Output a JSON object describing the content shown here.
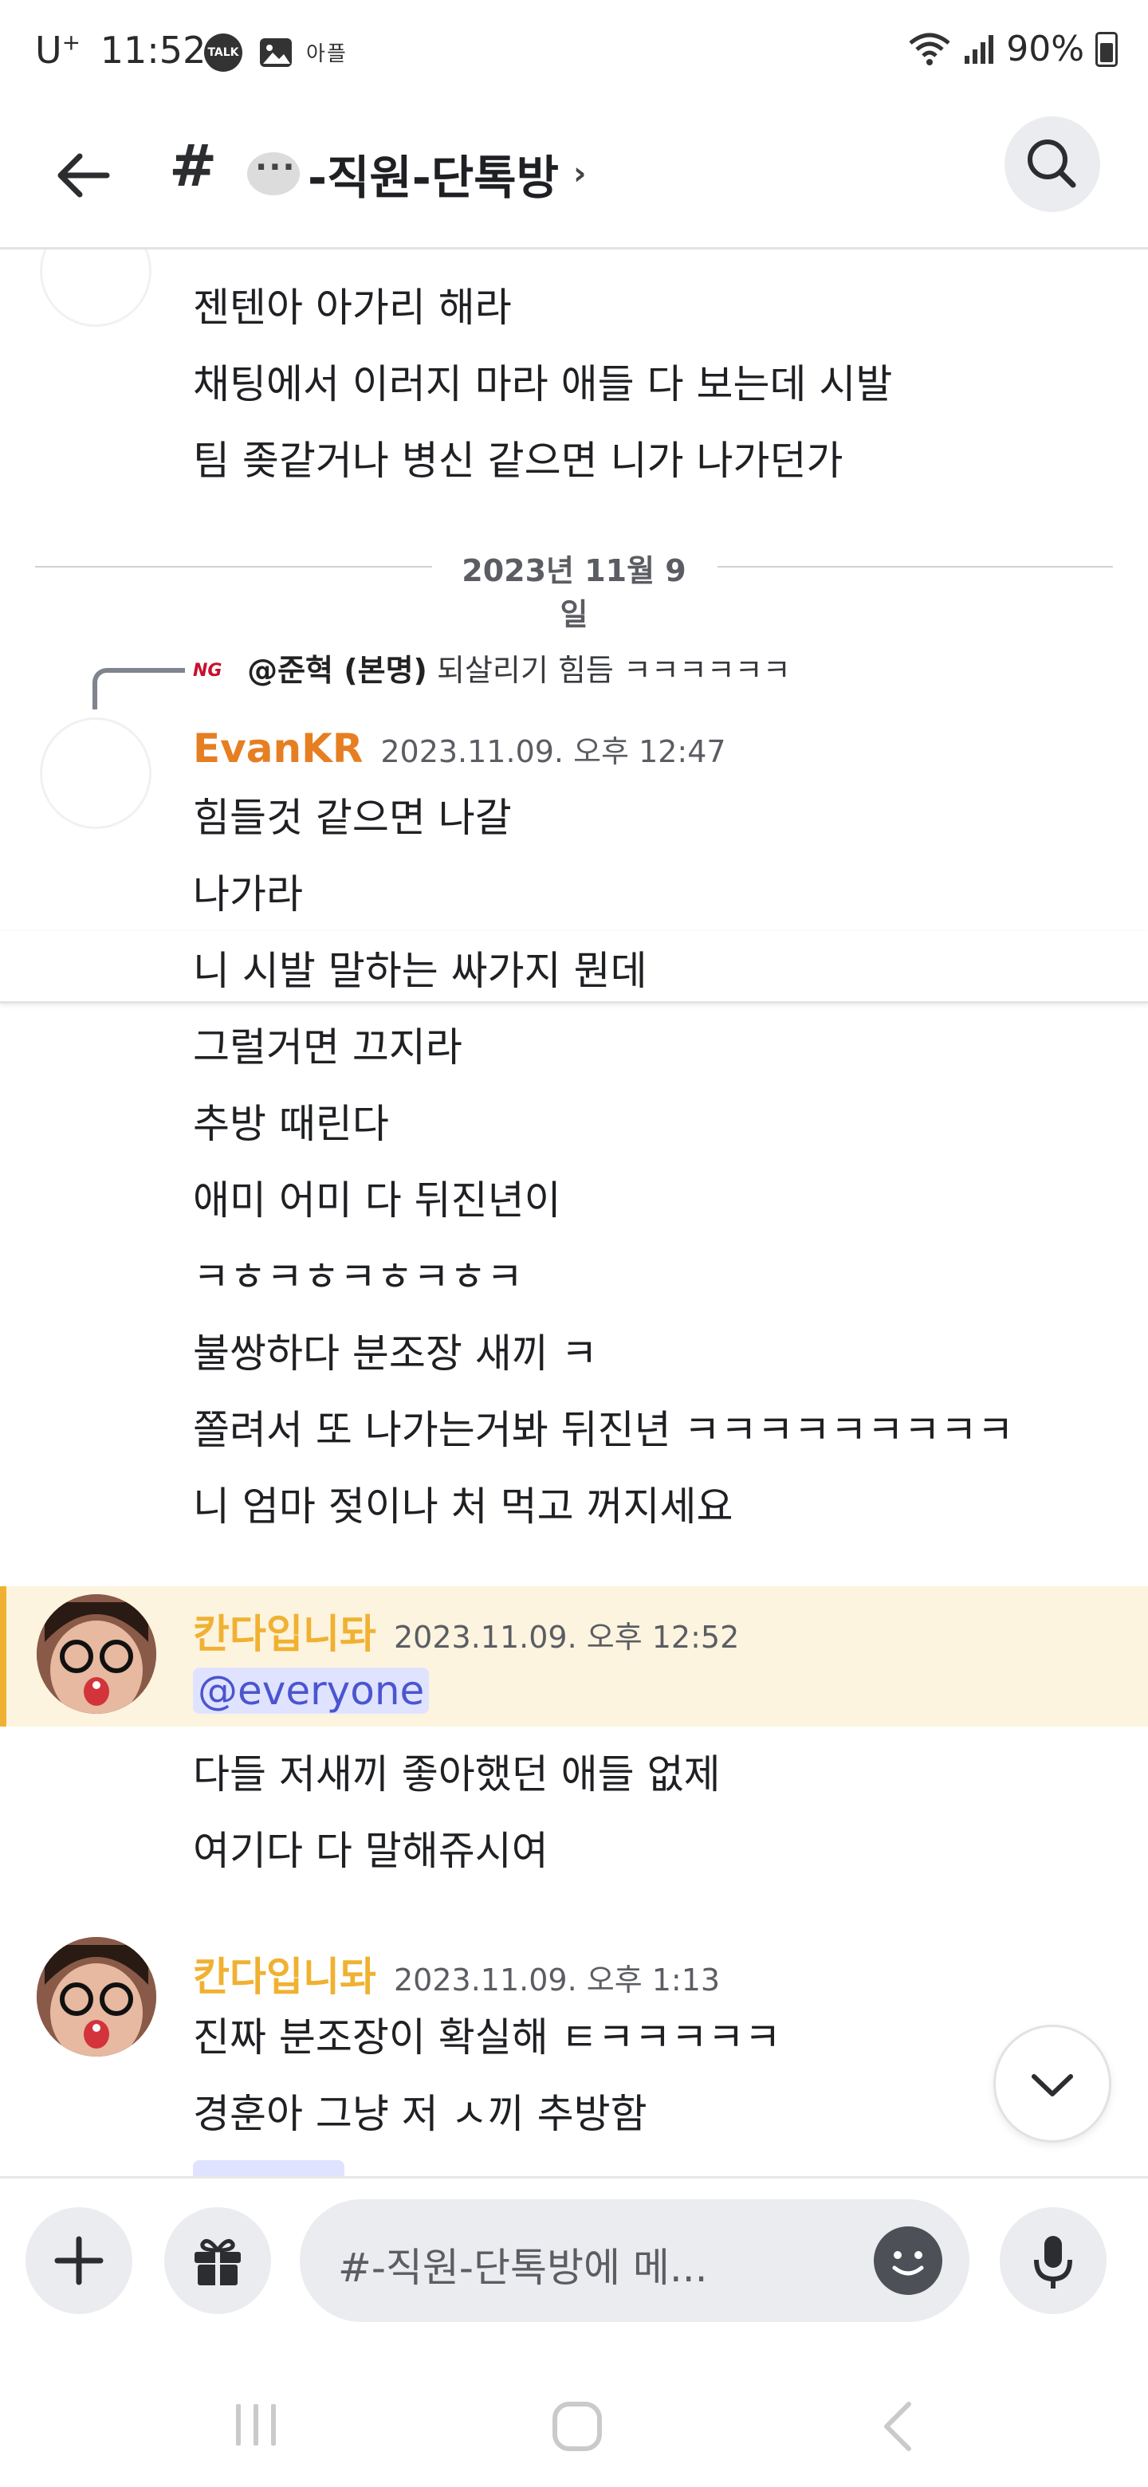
{
  "status_bar": {
    "time": "11:52",
    "carrier": "U",
    "carrier_sup": "+",
    "battery": "90%",
    "app_label": "TALK"
  },
  "header": {
    "hash": "#",
    "channel_name": "-직원-단톡방",
    "chevron": "›"
  },
  "messages": {
    "prev_lines": [
      "젠텐아 아가리 해라",
      "채팅에서 이러지 마라 애들 다 보는데 시발",
      "팀 좆같거나 병신 같으면 니가 나가던가"
    ],
    "date_divider": "2023년 11월 9일",
    "reply": {
      "name": "@준혁 (본명)",
      "text": " 되살리기 힘듬 ㅋㅋㅋㅋㅋㅋ"
    },
    "evan": {
      "author": "EvanKR",
      "timestamp": "2023.11.09. 오후 12:47",
      "lines": [
        "힘들것 같으면 나갈",
        "나가라",
        "니 시발 말하는 싸가지 뭔데",
        "그럴거면 끄지라",
        "추방 때린다",
        "애미 어미 다 뒤진년이",
        "ㅋㅎㅋㅎㅋㅎㅋㅎㅋ",
        "불쌍하다 분조장 새끼 ㅋ",
        "쫄려서 또 나가는거봐 뒤진년 ㅋㅋㅋㅋㅋㅋㅋㅋㅋ",
        "니 엄마 젖이나 처 먹고 꺼지세요"
      ]
    },
    "kanda1": {
      "author": "칸다입니돠",
      "timestamp": "2023.11.09. 오후 12:52",
      "mention": "@everyone",
      "lines": [
        "다들 저새끼 좋아했던 애들 없제",
        "여기다 다 말해쥬시여"
      ]
    },
    "kanda2": {
      "author": "칸다입니돠",
      "timestamp": "2023.11.09. 오후 1:13",
      "lines": [
        "진짜 분조장이 확실해 ㅌㅋㅋㅋㅋㅋ",
        "경훈아 그냥 저 ㅅ끼 추방함"
      ]
    }
  },
  "composer": {
    "placeholder": "#-직원-단톡방에 메..."
  },
  "colors": {
    "evan_name": "#e67e22",
    "kanda_name": "#f0b132",
    "mention_bg": "#fdf4df",
    "mention_border": "#f0b132",
    "mention_pill_text": "#4b55cf"
  },
  "icons": {
    "back": "arrow-left-icon",
    "search": "search-icon",
    "add": "plus-icon",
    "gift": "gift-icon",
    "emoji": "smile-icon",
    "mic": "microphone-icon",
    "scroll": "chevron-down-icon"
  }
}
